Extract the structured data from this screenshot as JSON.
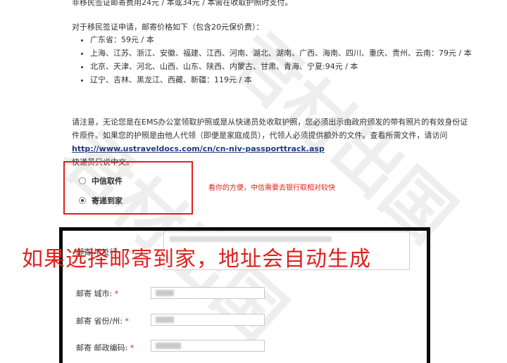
{
  "top_line": "非移民签证邮寄费用24元 / 本或34元 / 本需在收取护照时支付。",
  "immigrant_intro": "对于移民签证申请，邮寄价格如下（包含20元保价费）：",
  "fee_items": [
    "广东省：59元 / 本",
    "上海、江苏、浙江、安徽、福建、江西、河南、湖北、湖南、广西、海南、四川、重庆、贵州、云南：79元 / 本",
    "北京、天津、河北、山西、山东、陕西、内蒙古、甘肃、青海、宁夏:94元 / 本",
    "辽宁、吉林、黑龙江、西藏、新疆：119元 / 本"
  ],
  "notice": {
    "text": "请注意，无论您是在EMS办公室领取护照或是从快递员处收取护照，您必须出示由政府颁发的带有照片的有效身份证件原件。如果您的护照是由他人代领（即便是家庭成员），代领人必须提供额外的文件。查看所需文件，请访问",
    "link": "http://www.ustraveldocs.com/cn/cn-niv-passporttrack.asp",
    "courier_note": "快递员只说中文。"
  },
  "pickup_options": [
    {
      "label": "中信取件",
      "selected": false
    },
    {
      "label": "寄递到家",
      "selected": true
    }
  ],
  "annotation_note": "看你的方便，中信需要去银行取相对较快",
  "big_annotation": "如果选择邮寄到家，地址会自动生成",
  "address_form": {
    "address_label": "邮寄 地址行",
    "city_label": "邮寄 城市:",
    "province_label": "邮寄 省份/州:",
    "postal_label": "邮寄 邮政编码:",
    "required_mark": "*"
  },
  "watermark": "君材出国",
  "colors": {
    "annotation_red": "#e0201d",
    "link_blue": "#1d3d7a",
    "frame_black": "#0b0b0b"
  }
}
